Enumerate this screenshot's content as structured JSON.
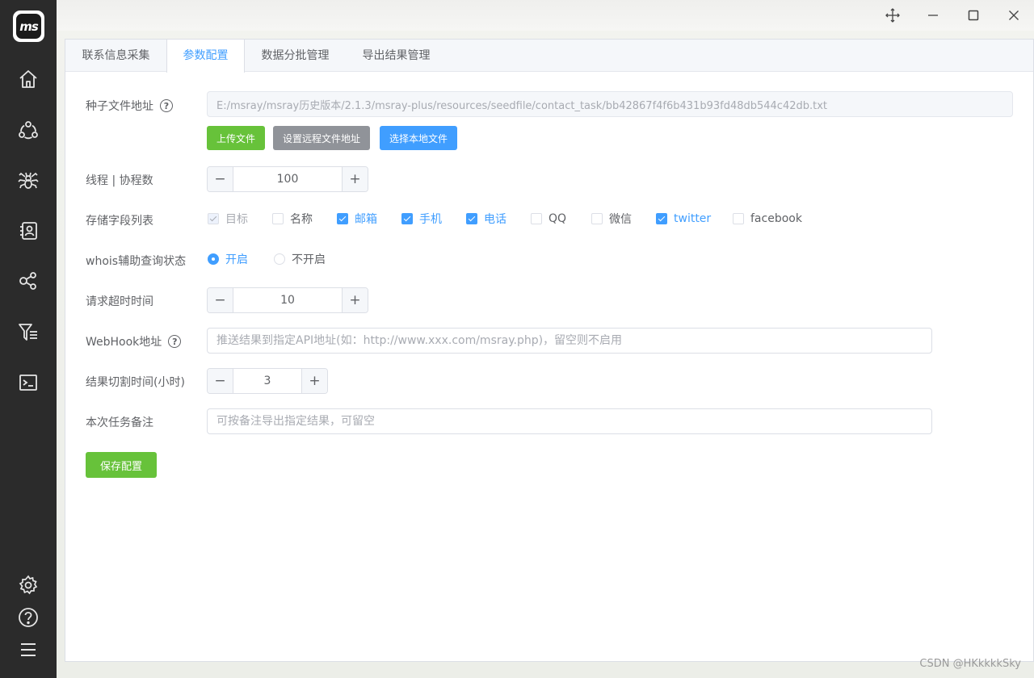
{
  "app": {
    "logo_text": "ms"
  },
  "sidebar": {
    "nav": [
      "home-icon",
      "community-icon",
      "spider-icon",
      "contacts-icon",
      "share-icon",
      "filter-list-icon",
      "terminal-icon"
    ],
    "bottom": [
      "settings-icon",
      "help-icon",
      "menu-icon"
    ]
  },
  "tabs": [
    {
      "label": "联系信息采集"
    },
    {
      "label": "参数配置",
      "active": true
    },
    {
      "label": "数据分批管理"
    },
    {
      "label": "导出结果管理"
    }
  ],
  "form": {
    "seed_file": {
      "label": "种子文件地址",
      "help": "?",
      "value": "E:/msray/msray历史版本/2.1.3/msray-plus/resources/seedfile/contact_task/bb42867f4f6b431b93fd48db544c42db.txt",
      "buttons": {
        "upload": "上传文件",
        "remote": "设置远程文件地址",
        "local": "选择本地文件"
      }
    },
    "threads": {
      "label": "线程 | 协程数",
      "value": "100",
      "minus": "−",
      "plus": "+"
    },
    "fields": {
      "label": "存储字段列表",
      "options": [
        {
          "label": "目标",
          "checked": true,
          "disabled": true
        },
        {
          "label": "名称",
          "checked": false
        },
        {
          "label": "邮箱",
          "checked": true
        },
        {
          "label": "手机",
          "checked": true
        },
        {
          "label": "电话",
          "checked": true
        },
        {
          "label": "QQ",
          "checked": false
        },
        {
          "label": "微信",
          "checked": false
        },
        {
          "label": "twitter",
          "checked": true
        },
        {
          "label": "facebook",
          "checked": false
        }
      ]
    },
    "whois": {
      "label": "whois辅助查询状态",
      "options": [
        {
          "label": "开启",
          "checked": true
        },
        {
          "label": "不开启",
          "checked": false
        }
      ]
    },
    "timeout": {
      "label": "请求超时时间",
      "value": "10",
      "minus": "−",
      "plus": "+"
    },
    "webhook": {
      "label": "WebHook地址",
      "help": "?",
      "placeholder": "推送结果到指定API地址(如：http://www.xxx.com/msray.php)，留空则不启用"
    },
    "cut_time": {
      "label": "结果切割时间(小时)",
      "value": "3",
      "minus": "−",
      "plus": "+"
    },
    "remark": {
      "label": "本次任务备注",
      "placeholder": "可按备注导出指定结果，可留空"
    },
    "save_label": "保存配置"
  },
  "colors": {
    "primary": "#409eff",
    "success": "#67c23a",
    "info": "#909399",
    "sidebar": "#2b2b2b"
  },
  "watermark": "CSDN @HKkkkkSky"
}
